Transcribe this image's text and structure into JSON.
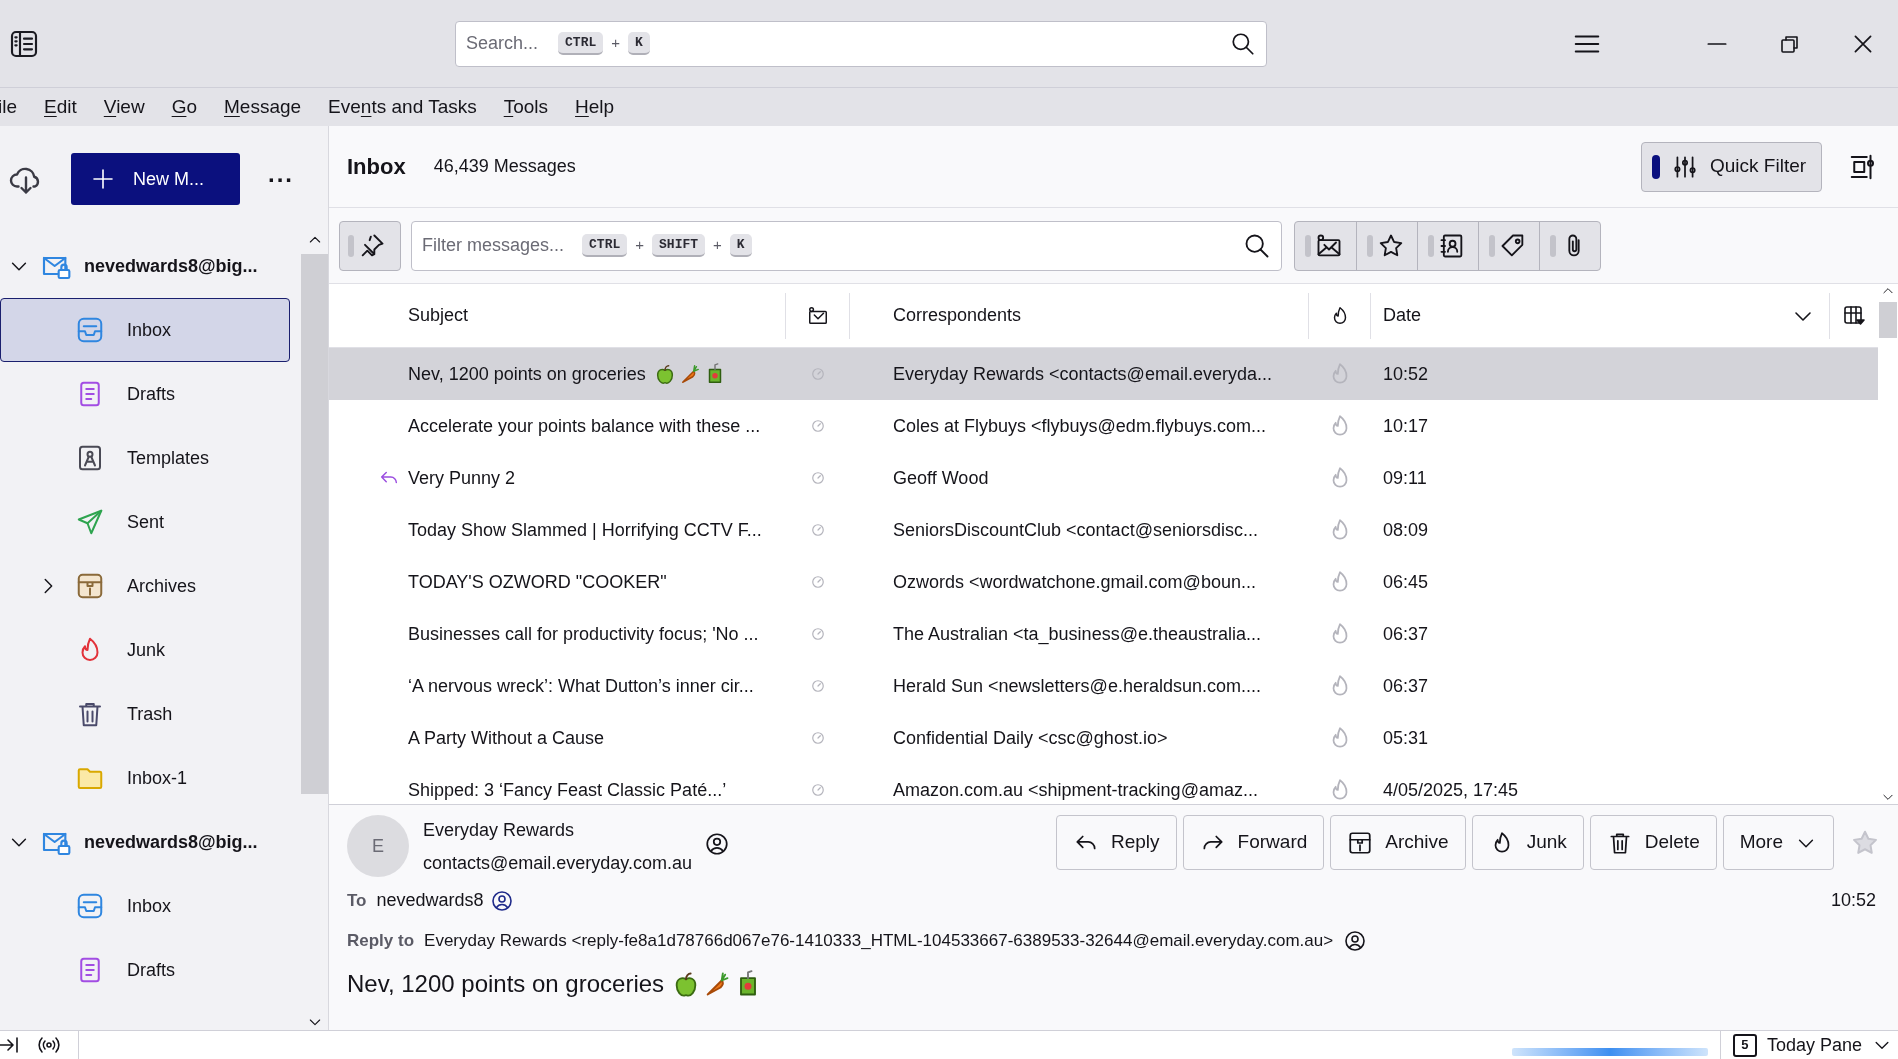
{
  "titlebar": {
    "search": {
      "placeholder": "Search...",
      "shortcut": [
        {
          "kind": "key",
          "text": "CTRL"
        },
        {
          "kind": "plus",
          "text": "+"
        },
        {
          "kind": "key",
          "text": "K"
        }
      ]
    }
  },
  "menu": [
    {
      "before": "ile"
    },
    {
      "key": "E",
      "after": "dit"
    },
    {
      "key": "V",
      "after": "iew"
    },
    {
      "key": "G",
      "after": "o"
    },
    {
      "key": "M",
      "after": "essage"
    },
    {
      "before": "Eve",
      "key": "n",
      "after": "ts and Tasks"
    },
    {
      "key": "T",
      "after": "ools"
    },
    {
      "key": "H",
      "after": "elp"
    }
  ],
  "sidebar": {
    "new_message": "New M...",
    "more": "...",
    "accounts": [
      {
        "name": "nevedwards8@big...",
        "expanded": true,
        "folders": [
          {
            "kind": "inbox",
            "label": "Inbox",
            "selected": true
          },
          {
            "kind": "drafts",
            "label": "Drafts",
            "selected": false
          },
          {
            "kind": "templates",
            "label": "Templates",
            "selected": false
          },
          {
            "kind": "sent",
            "label": "Sent",
            "selected": false
          },
          {
            "kind": "archives",
            "label": "Archives",
            "selected": false,
            "expanded": false
          },
          {
            "kind": "junk",
            "label": "Junk",
            "selected": false
          },
          {
            "kind": "trash",
            "label": "Trash",
            "selected": false
          },
          {
            "kind": "folder",
            "label": "Inbox-1",
            "selected": false
          }
        ]
      },
      {
        "name": "nevedwards8@big...",
        "expanded": true,
        "folders": [
          {
            "kind": "inbox",
            "label": "Inbox",
            "selected": false
          },
          {
            "kind": "drafts",
            "label": "Drafts",
            "selected": false
          }
        ]
      }
    ]
  },
  "list_header": {
    "folder": "Inbox",
    "count": "46,439 Messages",
    "quick_filter": {
      "label": "Quick Filter",
      "on": true
    }
  },
  "filter_bar": {
    "sticky_on": false,
    "placeholder": "Filter messages...",
    "shortcut": [
      {
        "kind": "key",
        "text": "CTRL"
      },
      {
        "kind": "plus",
        "text": "+"
      },
      {
        "kind": "key",
        "text": "SHIFT"
      },
      {
        "kind": "plus",
        "text": "+"
      },
      {
        "kind": "key",
        "text": "K"
      }
    ],
    "toggles": [
      {
        "kind": "unread",
        "on": false
      },
      {
        "kind": "starred",
        "on": false
      },
      {
        "kind": "contact",
        "on": false
      },
      {
        "kind": "tags",
        "on": false
      },
      {
        "kind": "attachment",
        "on": false
      }
    ]
  },
  "table": {
    "columns": [
      "Subject",
      "Correspondents",
      "Date"
    ],
    "rows": [
      {
        "subject": "Nev, 1200 points on groceries",
        "emoji": true,
        "correspondent": "Everyday Rewards <contacts@email.everyda...",
        "date": "10:52",
        "selected": true,
        "replied": false
      },
      {
        "subject": "Accelerate your points balance with these ...",
        "emoji": false,
        "correspondent": "Coles at Flybuys <flybuys@edm.flybuys.com...",
        "date": "10:17",
        "selected": false,
        "replied": false
      },
      {
        "subject": "Very Punny 2",
        "emoji": false,
        "correspondent": "Geoff Wood",
        "date": "09:11",
        "selected": false,
        "replied": true
      },
      {
        "subject": "Today Show Slammed | Horrifying CCTV F...",
        "emoji": false,
        "correspondent": "SeniorsDiscountClub <contact@seniorsdisc...",
        "date": "08:09",
        "selected": false,
        "replied": false
      },
      {
        "subject": "TODAY'S OZWORD \"COOKER\"",
        "emoji": false,
        "correspondent": "Ozwords <wordwatchone.gmail.com@boun...",
        "date": "06:45",
        "selected": false,
        "replied": false
      },
      {
        "subject": "Businesses call for productivity focus; 'No ...",
        "emoji": false,
        "correspondent": "The Australian <ta_business@e.theaustralia...",
        "date": "06:37",
        "selected": false,
        "replied": false
      },
      {
        "subject": "‘A nervous wreck’: What Dutton’s inner cir...",
        "emoji": false,
        "correspondent": "Herald Sun <newsletters@e.heraldsun.com....",
        "date": "06:37",
        "selected": false,
        "replied": false
      },
      {
        "subject": "A Party Without a Cause",
        "emoji": false,
        "correspondent": "Confidential Daily <csc@ghost.io>",
        "date": "05:31",
        "selected": false,
        "replied": false
      },
      {
        "subject": "Shipped: 3 ‘Fancy Feast Classic Paté...’",
        "emoji": false,
        "correspondent": "Amazon.com.au <shipment-tracking@amaz...",
        "date": "4/05/2025, 17:45",
        "selected": false,
        "replied": false
      }
    ]
  },
  "message": {
    "avatar": "E",
    "from_name": "Everyday Rewards",
    "from_email": "contacts@email.everyday.com.au",
    "buttons": [
      {
        "kind": "reply",
        "label": "Reply"
      },
      {
        "kind": "forward",
        "label": "Forward"
      },
      {
        "kind": "archive",
        "label": "Archive"
      },
      {
        "kind": "junk",
        "label": "Junk"
      },
      {
        "kind": "delete",
        "label": "Delete"
      },
      {
        "kind": "more",
        "label": "More"
      }
    ],
    "starred": false,
    "to_label": "To",
    "to": "nevedwards8",
    "time": "10:52",
    "reply_to_label": "Reply to",
    "reply_to": "Everyday Rewards <reply-fe8a1d78766d067e76-1410333_HTML-104533667-6389533-32644@email.everyday.com.au>",
    "subject": "Nev, 1200 points on groceries",
    "emoji": true
  },
  "status_bar": {
    "calendar_day": "5",
    "today_pane": "Today Pane"
  }
}
